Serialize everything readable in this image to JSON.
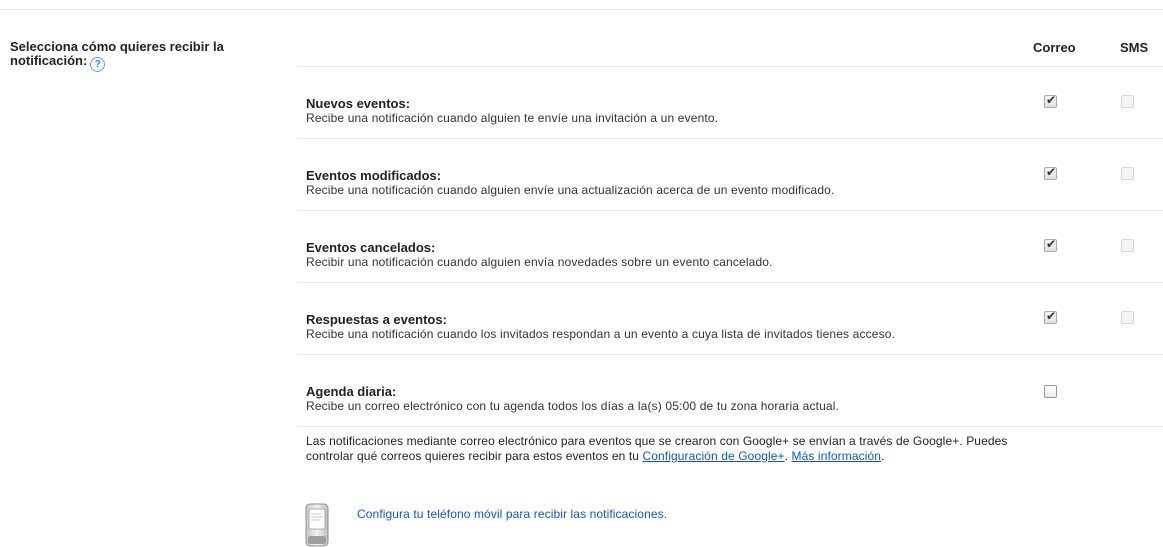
{
  "section": {
    "label": "Selecciona cómo quieres recibir la notificación:",
    "help_icon": "?"
  },
  "columns": {
    "correo": "Correo",
    "sms": "SMS"
  },
  "rows": [
    {
      "title": "Nuevos eventos:",
      "description": "Recibe una notificación cuando alguien te envíe una invitación a un evento.",
      "correo_checked": true,
      "sms_checked": false
    },
    {
      "title": "Eventos modificados:",
      "description": "Recibe una notificación cuando alguien envíe una actualización acerca de un evento modificado.",
      "correo_checked": true,
      "sms_checked": false
    },
    {
      "title": "Eventos cancelados:",
      "description": "Recibir una notificación cuando alguien envía novedades sobre un evento cancelado.",
      "correo_checked": true,
      "sms_checked": false
    },
    {
      "title": "Respuestas a eventos:",
      "description": "Recibe una notificación cuando los invitados respondan a un evento a cuya lista de invitados tienes acceso.",
      "correo_checked": true,
      "sms_checked": false
    },
    {
      "title": "Agenda diaria:",
      "description": "Recibe un correo electrónico con tu agenda todos los días a la(s) 05:00 de tu zona horaria actual.",
      "correo_checked": false
    }
  ],
  "info": {
    "text": "Las notificaciones mediante correo electrónico para eventos que se crearon con Google+ se envían a través de Google+. Puedes controlar qué correos quieres recibir para estos eventos en tu ",
    "link_settings": "Configuración de Google+",
    "separator": ". ",
    "link_more": "Más información",
    "end": "."
  },
  "mobile": {
    "link": "Configura tu teléfono móvil para recibir las notificaciones.",
    "icon": "mobile-phone-icon"
  },
  "colors": {
    "link": "#1155cc",
    "divider": "#ebebeb"
  }
}
